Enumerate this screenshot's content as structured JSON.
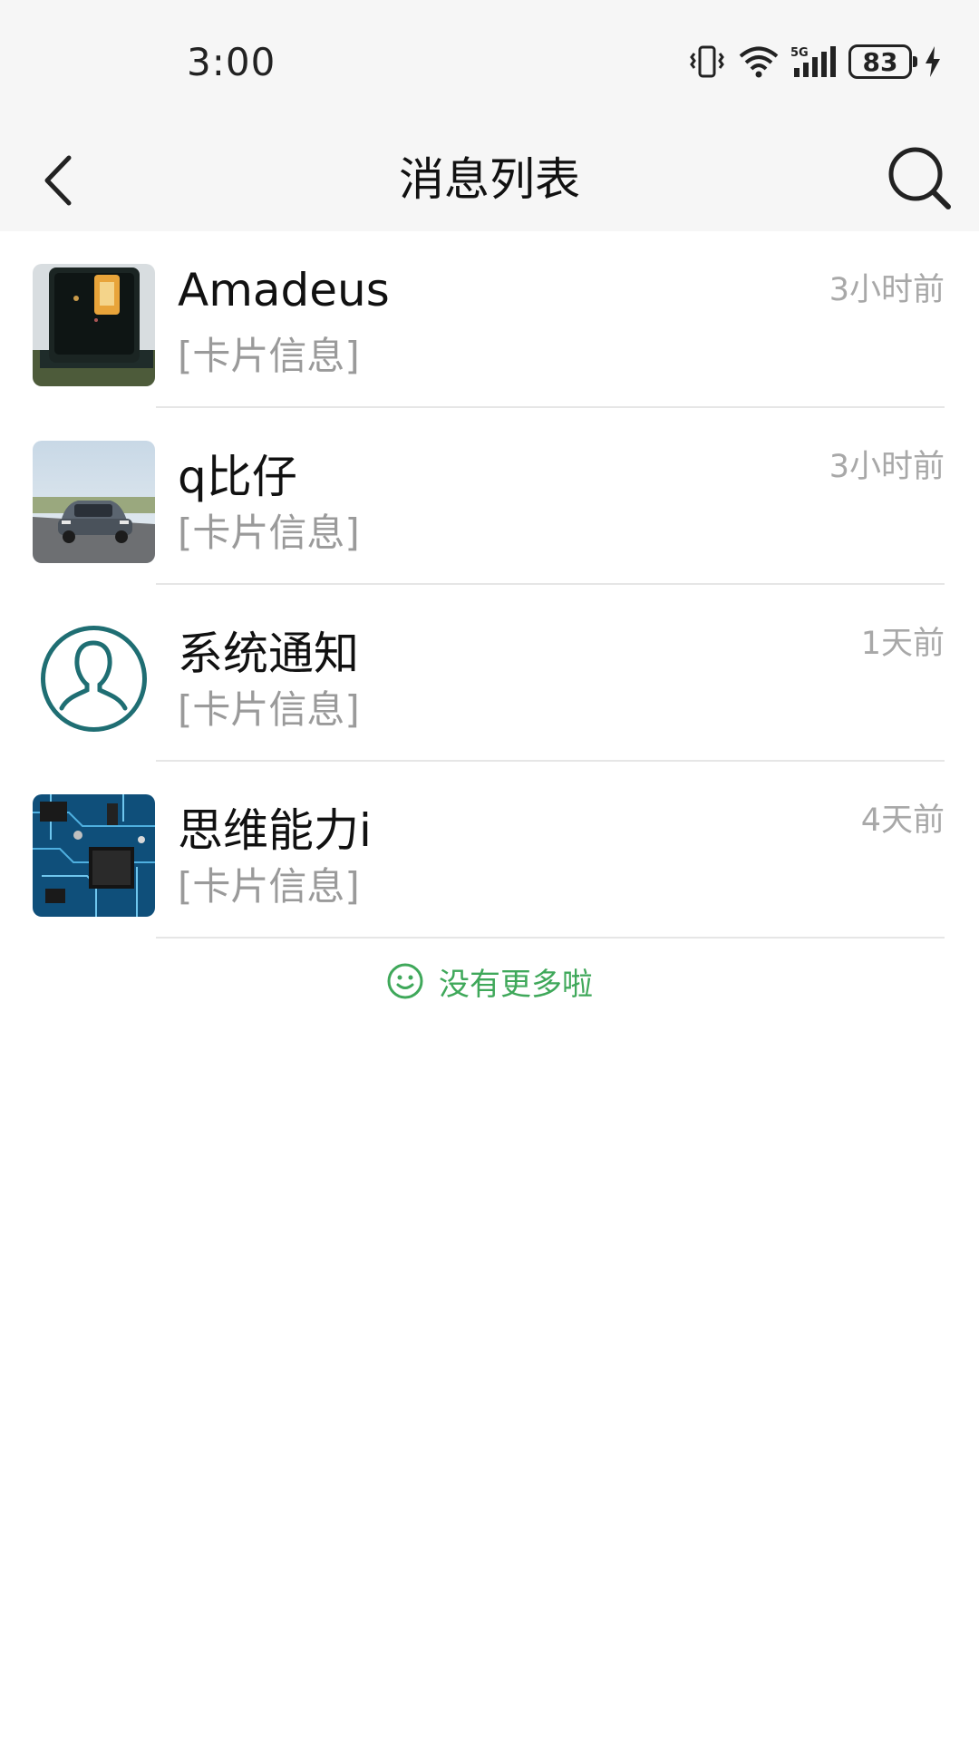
{
  "status": {
    "time": "3:00",
    "battery": "83"
  },
  "nav": {
    "title": "消息列表",
    "back_icon": "chevron-left-icon",
    "search_icon": "search-icon"
  },
  "messages": [
    {
      "name": "Amadeus",
      "preview": "[卡片信息]",
      "time": "3小时前",
      "avatar": "phone-photo"
    },
    {
      "name": "q比仔",
      "preview": "[卡片信息]",
      "time": "3小时前",
      "avatar": "car-photo"
    },
    {
      "name": "系统通知",
      "preview": "[卡片信息]",
      "time": "1天前",
      "avatar": "default-user-icon"
    },
    {
      "name": "思维能力i",
      "preview": "[卡片信息]",
      "time": "4天前",
      "avatar": "circuit-board-photo"
    }
  ],
  "footer": {
    "text": "没有更多啦",
    "icon": "smiley-icon",
    "color": "#3fa85a"
  },
  "colors": {
    "header_bg": "#f6f6f6",
    "secondary_text": "#9a9a9a",
    "avatar_ring": "#1f6e73"
  }
}
